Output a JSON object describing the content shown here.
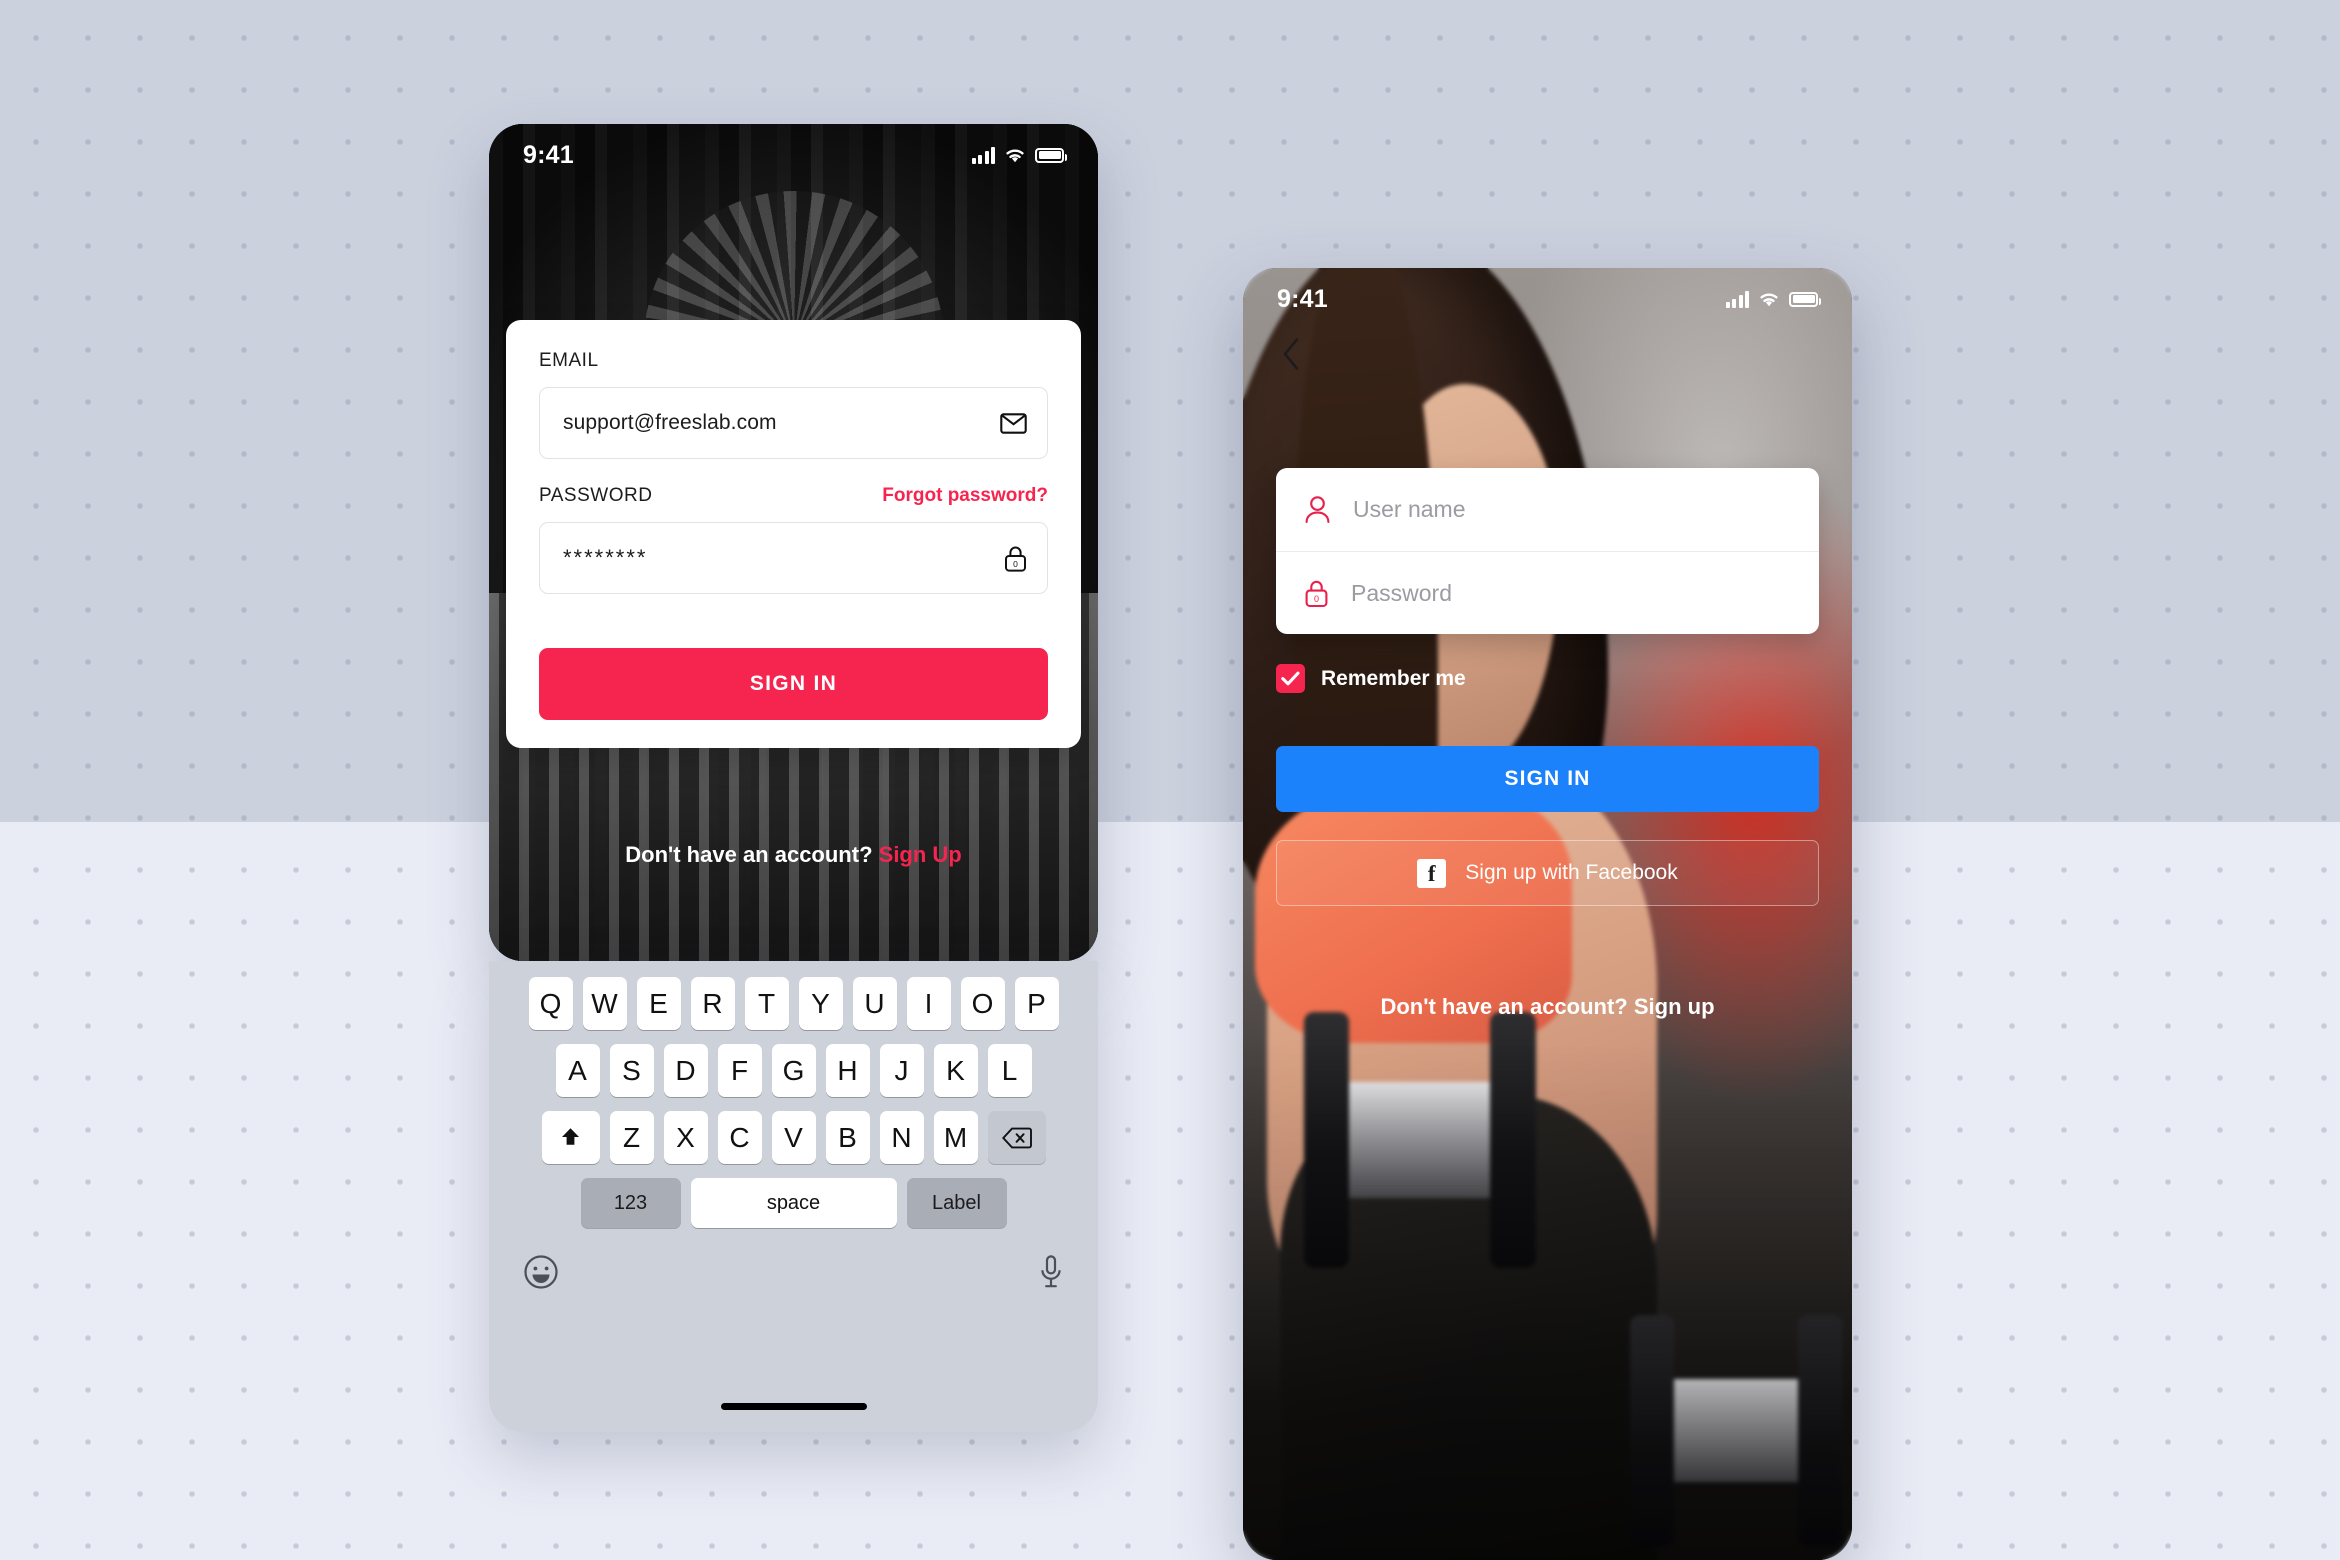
{
  "background": {
    "top_color": "#ccd1de",
    "bottom_color": "#e9ecf5",
    "dot_pattern": "dot-grid"
  },
  "phone_left": {
    "status_bar": {
      "time": "9:41",
      "icons": [
        "cellular-signal-icon",
        "wifi-icon",
        "battery-icon"
      ]
    },
    "backdrop": "black-and-white-architecture-photo",
    "login_card": {
      "email": {
        "label": "EMAIL",
        "value": "support@freeslab.com",
        "icon": "envelope-icon"
      },
      "password": {
        "label": "PASSWORD",
        "forgot_label": "Forgot password?",
        "value": "********",
        "icon": "lock-icon"
      },
      "submit_label": "SIGN IN",
      "submit_color": "#f5254f"
    },
    "signup_prompt": {
      "text": "Don't have an account?",
      "link": "Sign Up",
      "link_color": "#f5254f"
    },
    "keyboard": {
      "row1": [
        "Q",
        "W",
        "E",
        "R",
        "T",
        "Y",
        "U",
        "I",
        "O",
        "P"
      ],
      "row2": [
        "A",
        "S",
        "D",
        "F",
        "G",
        "H",
        "J",
        "K",
        "L"
      ],
      "row3": [
        "Z",
        "X",
        "C",
        "V",
        "B",
        "N",
        "M"
      ],
      "shift_key": "shift-icon",
      "backspace_key": "backspace-icon",
      "numbers_key": "123",
      "space_key": "space",
      "label_key": "Label",
      "emoji_key": "emoji-icon",
      "dictation_key": "microphone-icon"
    }
  },
  "phone_right": {
    "status_bar": {
      "time": "9:41",
      "icons": [
        "cellular-signal-icon",
        "wifi-icon",
        "battery-icon"
      ]
    },
    "backdrop": "woman-lifting-dumbbells-gym-photo",
    "back_button": "chevron-left-icon",
    "form": {
      "username": {
        "placeholder": "User name",
        "icon": "user-icon"
      },
      "password": {
        "placeholder": "Password",
        "icon": "lock-icon"
      }
    },
    "remember_me": {
      "label": "Remember me",
      "checked": true,
      "color": "#f5254f"
    },
    "submit_label": "SIGN IN",
    "submit_color": "#1c82fb",
    "facebook_label": "Sign up with Facebook",
    "facebook_icon": "facebook-f-icon",
    "signup_prompt": "Don't have an account? Sign up"
  }
}
